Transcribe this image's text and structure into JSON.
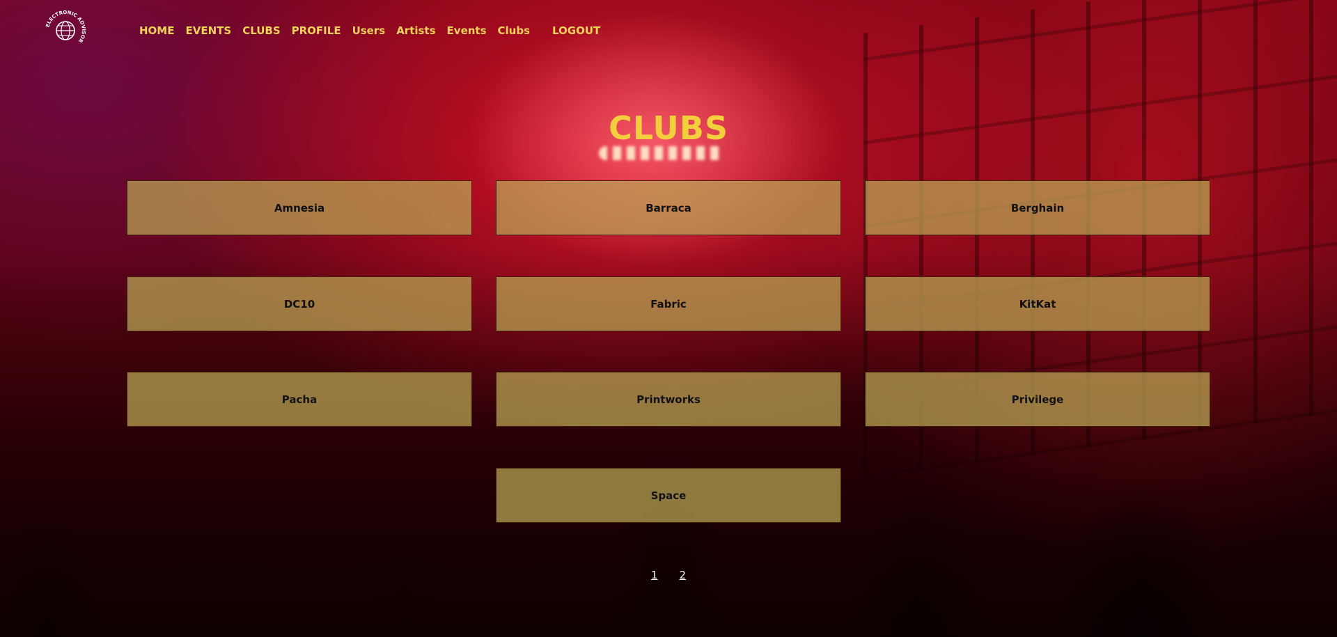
{
  "logo": {
    "icon": "globe-logo-icon",
    "text": "ELECTRONIC ADVISOR"
  },
  "nav": {
    "items": [
      "HOME",
      "EVENTS",
      "CLUBS",
      "PROFILE",
      "Users",
      "Artists",
      "Events",
      "Clubs"
    ],
    "logout": "LOGOUT"
  },
  "page": {
    "title": "CLUBS"
  },
  "clubs": [
    "Amnesia",
    "Barraca",
    "Berghain",
    "DC10",
    "Fabric",
    "KitKat",
    "Pacha",
    "Printworks",
    "Privilege",
    "Space"
  ],
  "pagination": {
    "pages": [
      "1",
      "2"
    ]
  },
  "colors": {
    "accent": "#f3cf3d",
    "card": "#bba856"
  }
}
